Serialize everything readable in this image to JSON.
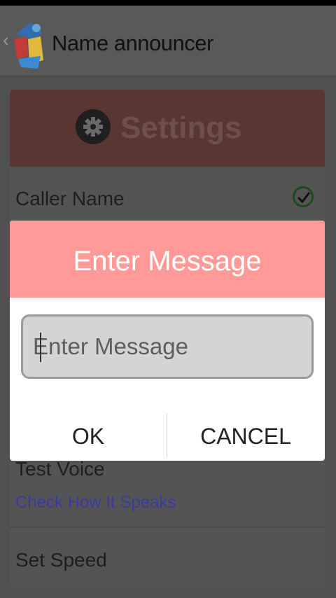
{
  "app": {
    "title": "Name announcer"
  },
  "settings": {
    "header_title": "Settings",
    "rows": [
      {
        "label": "Caller Name"
      },
      {
        "label": "Test Voice",
        "subtitle": "Check How It Speaks"
      },
      {
        "label": "Set Speed"
      }
    ]
  },
  "dialog": {
    "title": "Enter Message",
    "input_placeholder": "Enter Message",
    "input_value": "",
    "ok_label": "OK",
    "cancel_label": "CANCEL"
  },
  "colors": {
    "dialog_header": "#ff9a98",
    "panel_header": "#5a3632",
    "subtitle_link": "#3a3aa0"
  }
}
